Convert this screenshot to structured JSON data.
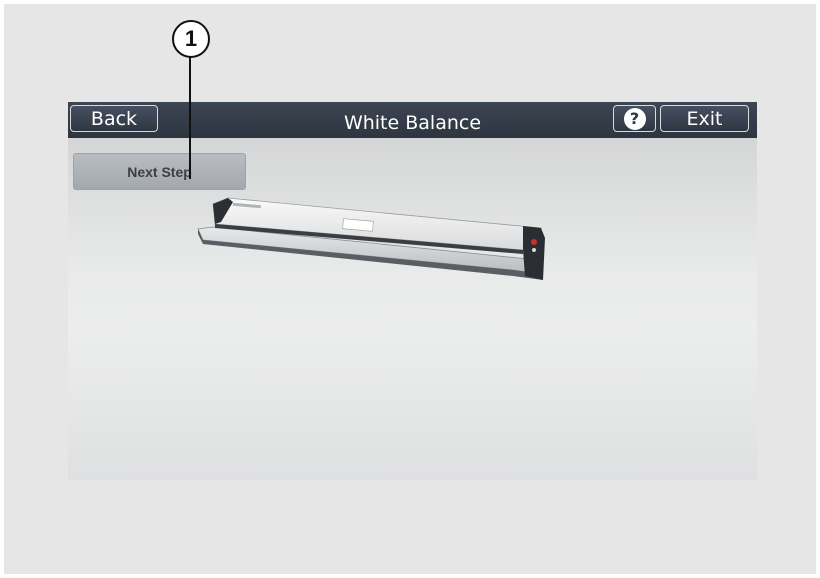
{
  "callout": {
    "number": "1"
  },
  "titlebar": {
    "back_label": "Back",
    "title": "White Balance",
    "help_label": "?",
    "exit_label": "Exit"
  },
  "main": {
    "next_step_label": "Next Step"
  },
  "icons": {
    "help": "help-icon",
    "scanner": "scanner-image"
  }
}
